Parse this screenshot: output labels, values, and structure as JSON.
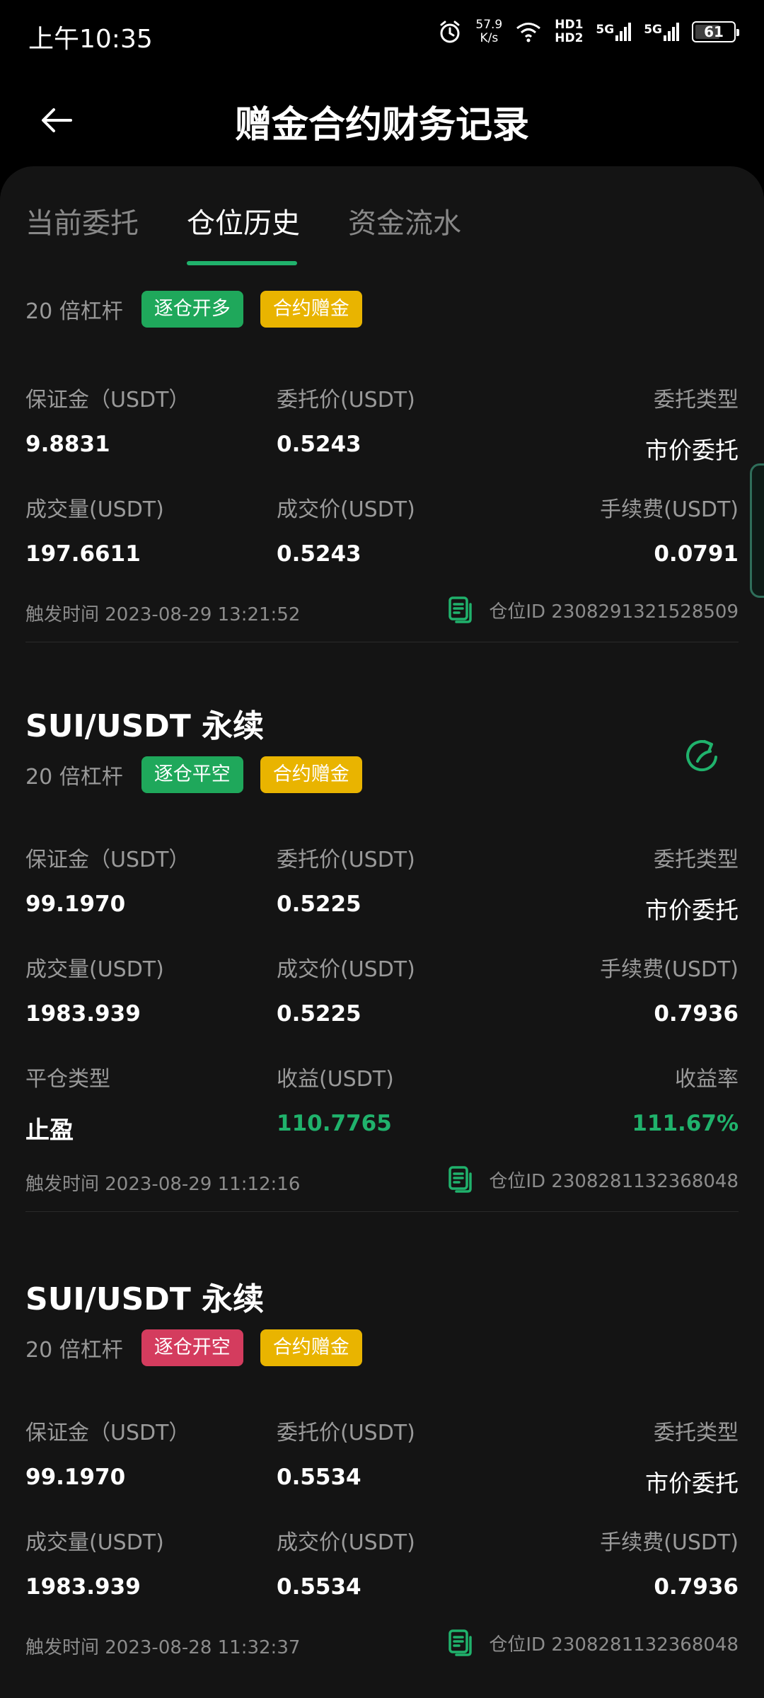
{
  "status_bar": {
    "time": "上午10:35",
    "net_speed_value": "57.9",
    "net_speed_unit": "K/s",
    "hd1": "HD1",
    "hd2": "HD2",
    "signal1_label": "5G",
    "signal2_label": "5G",
    "battery": "61"
  },
  "header": {
    "title": "赠金合约财务记录"
  },
  "tabs": [
    {
      "label": "当前委托",
      "active": false
    },
    {
      "label": "仓位历史",
      "active": true
    },
    {
      "label": "资金流水",
      "active": false
    }
  ],
  "labels": {
    "margin": "保证金（USDT）",
    "order_price": "委托价(USDT)",
    "order_type": "委托类型",
    "filled_amount": "成交量(USDT)",
    "filled_price": "成交价(USDT)",
    "fee": "手续费(USDT)",
    "close_type": "平仓类型",
    "pnl": "收益(USDT)",
    "pnl_rate": "收益率",
    "trigger_prefix": "触发时间",
    "position_prefix": "仓位ID"
  },
  "records": [
    {
      "title": "",
      "leverage": "20 倍杠杆",
      "tags": [
        "逐仓开多",
        "合约赠金"
      ],
      "margin": "9.8831",
      "order_price": "0.5243",
      "order_type": "市价委托",
      "filled_amount": "197.6611",
      "filled_price": "0.5243",
      "fee": "0.0791",
      "trigger_time": "触发时间 2023-08-29 13:21:52",
      "position_id": "仓位ID 2308291321528509"
    },
    {
      "title": "SUI/USDT 永续",
      "leverage": "20 倍杠杆",
      "tags": [
        "逐仓平空",
        "合约赠金"
      ],
      "margin": "99.1970",
      "order_price": "0.5225",
      "order_type": "市价委托",
      "filled_amount": "1983.939",
      "filled_price": "0.5225",
      "fee": "0.7936",
      "close_type": "止盈",
      "pnl": "110.7765",
      "pnl_rate": "111.67%",
      "trigger_time": "触发时间 2023-08-29 11:12:16",
      "position_id": "仓位ID 2308281132368048"
    },
    {
      "title": "SUI/USDT 永续",
      "leverage": "20 倍杠杆",
      "tags": [
        "逐仓开空",
        "合约赠金"
      ],
      "margin": "99.1970",
      "order_price": "0.5534",
      "order_type": "市价委托",
      "filled_amount": "1983.939",
      "filled_price": "0.5534",
      "fee": "0.7936",
      "trigger_time": "触发时间 2023-08-28 11:32:37",
      "position_id": "仓位ID 2308281132368048"
    }
  ],
  "colors": {
    "accent_green": "#20b26c",
    "tag_green": "#1fa85b",
    "tag_red": "#d43c5e",
    "tag_yellow": "#e9b400",
    "panel_bg": "#141414"
  },
  "icons": {
    "back": "arrow-left-icon",
    "document": "document-icon",
    "share": "share-refresh-icon",
    "alarm": "alarm-icon",
    "wifi": "wifi-icon"
  }
}
